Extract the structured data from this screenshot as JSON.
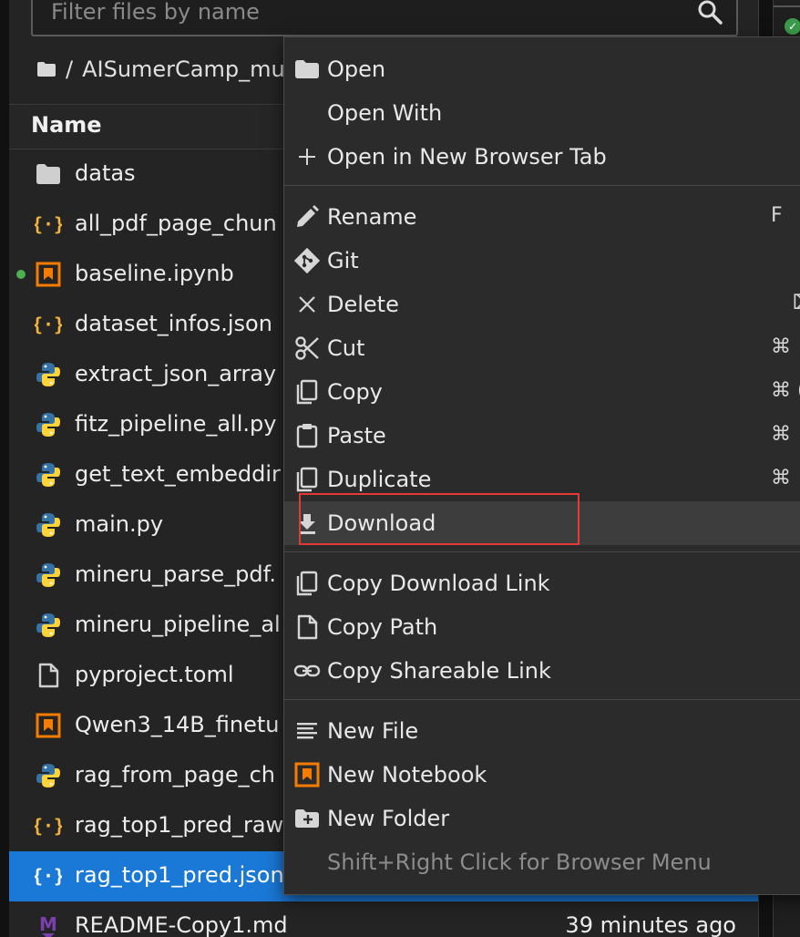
{
  "filter": {
    "placeholder": "Filter files by name"
  },
  "breadcrumb": {
    "separator": "/",
    "path": "AISumerCamp_mu"
  },
  "table_header": {
    "name": "Name"
  },
  "files": [
    {
      "name": "datas",
      "icon": "folder-icon"
    },
    {
      "name": "all_pdf_page_chun",
      "icon": "json-icon"
    },
    {
      "name": "baseline.ipynb",
      "icon": "notebook-icon",
      "running": true
    },
    {
      "name": "dataset_infos.json",
      "icon": "json-icon"
    },
    {
      "name": "extract_json_array",
      "icon": "python-icon"
    },
    {
      "name": "fitz_pipeline_all.py",
      "icon": "python-icon"
    },
    {
      "name": "get_text_embeddir",
      "icon": "python-icon"
    },
    {
      "name": "main.py",
      "icon": "python-icon"
    },
    {
      "name": "mineru_parse_pdf.",
      "icon": "python-icon"
    },
    {
      "name": "mineru_pipeline_al",
      "icon": "python-icon"
    },
    {
      "name": "pyproject.toml",
      "icon": "file-icon"
    },
    {
      "name": "Qwen3_14B_finetu",
      "icon": "notebook-icon"
    },
    {
      "name": "rag_from_page_ch",
      "icon": "python-icon"
    },
    {
      "name": "rag_top1_pred_raw",
      "icon": "json-icon"
    },
    {
      "name": "rag_top1_pred.json",
      "icon": "json-icon",
      "selected": true
    },
    {
      "name": "README-Copy1.md",
      "icon": "markdown-icon",
      "modified": "39 minutes ago"
    }
  ],
  "context_menu": {
    "open": "Open",
    "open_with": "Open With",
    "open_new_tab": "Open in New Browser Tab",
    "rename": "Rename",
    "rename_key": "F",
    "git": "Git",
    "delete": "Delete",
    "delete_key": "⌦",
    "cut": "Cut",
    "cut_key": "⌘",
    "copy": "Copy",
    "copy_key": "⌘ (",
    "paste": "Paste",
    "paste_key": "⌘",
    "duplicate": "Duplicate",
    "duplicate_key": "⌘",
    "download": "Download",
    "copy_download_link": "Copy Download Link",
    "copy_path": "Copy Path",
    "copy_shareable_link": "Copy Shareable Link",
    "new_file": "New File",
    "new_notebook": "New Notebook",
    "new_folder": "New Folder",
    "browser_menu_hint": "Shift+Right Click for Browser Menu"
  },
  "colors": {
    "selection": "#1a78d6",
    "highlight_box": "#e53935",
    "notebook_orange": "#f57c00",
    "json_yellow": "#f2b43a",
    "python_blue": "#3572a5",
    "python_yellow": "#ffd43b",
    "running_dot": "#4caf50",
    "markdown_purple": "#7b3fb0"
  }
}
